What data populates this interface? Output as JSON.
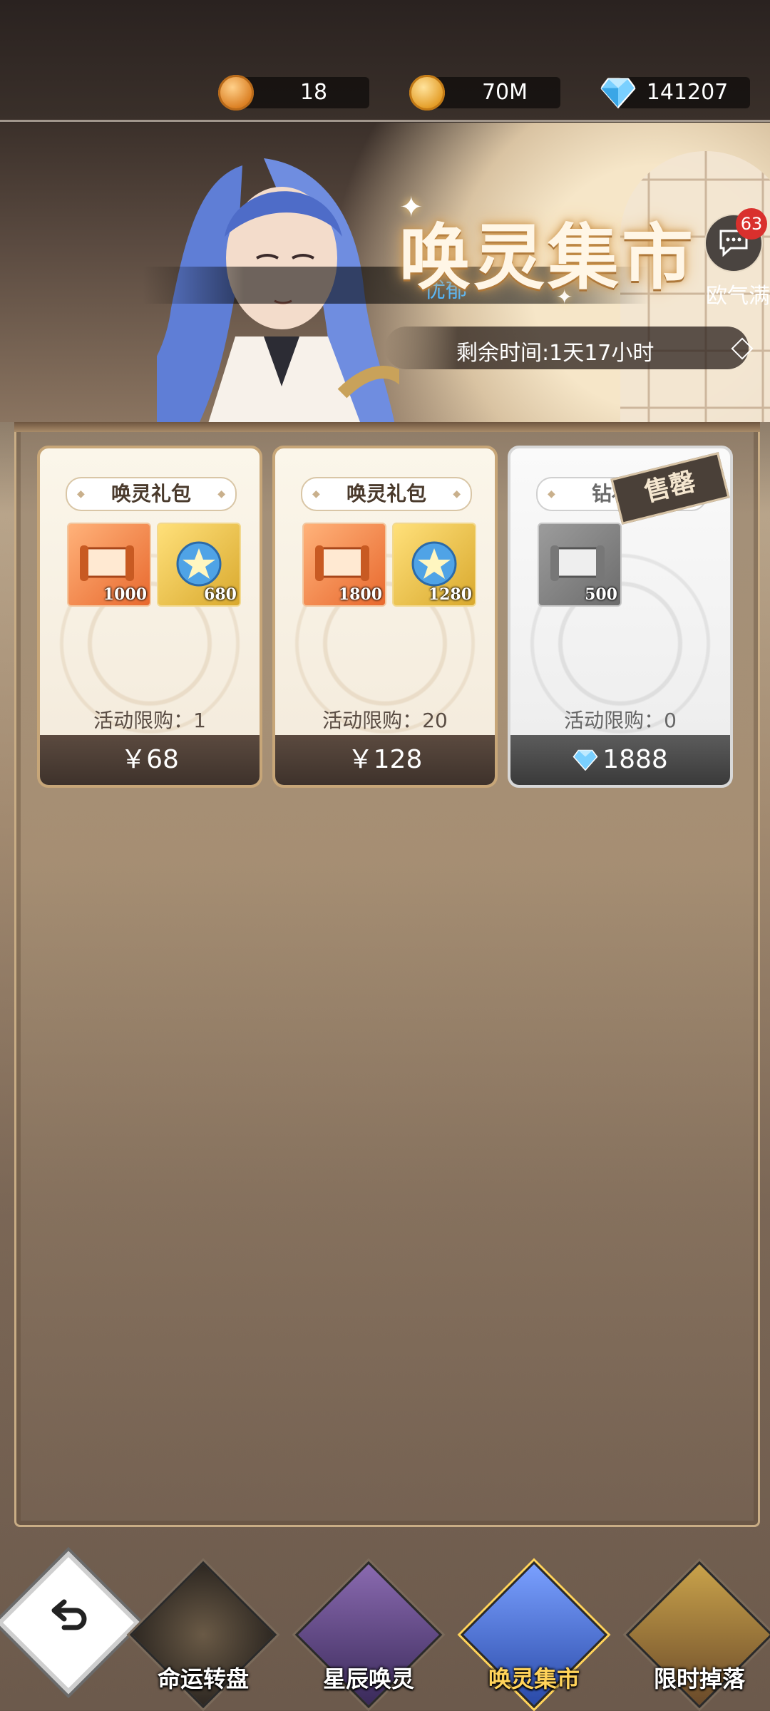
{
  "resources": [
    {
      "icon": "fate-coin-icon",
      "value": "18"
    },
    {
      "icon": "gold-coin-icon",
      "value": "70M"
    },
    {
      "icon": "diamond-icon",
      "value": "141207"
    }
  ],
  "ticker": {
    "prefix": "欧气满满的维序者",
    "highlight": "忧郁"
  },
  "banner": {
    "title": "唤灵集市",
    "remaining_time": "剩余时间:1天17小时"
  },
  "chat": {
    "badge": "63"
  },
  "cards": [
    {
      "name": "唤灵礼包",
      "items": [
        {
          "icon": "summon-scroll-icon",
          "qty": "1000"
        },
        {
          "icon": "star-orb-icon",
          "qty": "680"
        }
      ],
      "limit": "活动限购：1",
      "price": "￥68",
      "sold_out": false
    },
    {
      "name": "唤灵礼包",
      "items": [
        {
          "icon": "summon-scroll-icon",
          "qty": "1800"
        },
        {
          "icon": "star-orb-icon",
          "qty": "1280"
        }
      ],
      "limit": "活动限购：20",
      "price": "￥128",
      "sold_out": false
    },
    {
      "name": "钻石礼",
      "items": [
        {
          "icon": "summon-scroll-icon",
          "qty": "500"
        }
      ],
      "limit": "活动限购：0",
      "price": "1888",
      "sold_out": true,
      "stamp": "售罄"
    }
  ],
  "nav": {
    "tabs": [
      {
        "label": "命运转盘",
        "active": false
      },
      {
        "label": "星辰唤灵",
        "active": false
      },
      {
        "label": "唤灵集市",
        "active": true
      },
      {
        "label": "限时掉落",
        "active": false
      }
    ]
  },
  "colors": {
    "accent_gold": "#ffd35a",
    "badge_red": "#d9302d",
    "ticker_highlight": "#4fb6ff"
  }
}
